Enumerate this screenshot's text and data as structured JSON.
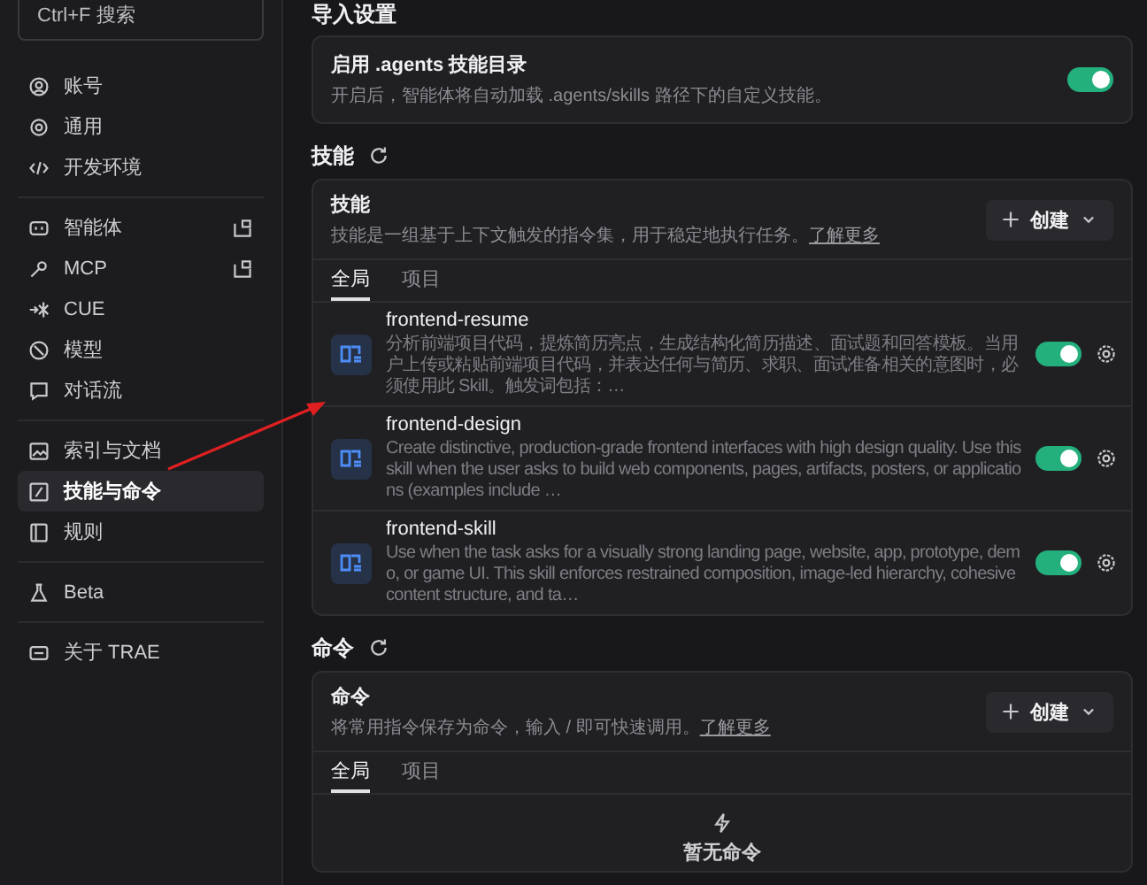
{
  "sidebar": {
    "search": {
      "placeholder": "Ctrl+F 搜索"
    },
    "groups": [
      {
        "items": [
          {
            "label": "账号",
            "selected": false,
            "external": false
          },
          {
            "label": "通用",
            "selected": false,
            "external": false
          },
          {
            "label": "开发环境",
            "selected": false,
            "external": false
          }
        ]
      },
      {
        "items": [
          {
            "label": "智能体",
            "selected": false,
            "external": true
          },
          {
            "label": "MCP",
            "selected": false,
            "external": true
          },
          {
            "label": "CUE",
            "selected": false,
            "external": false
          },
          {
            "label": "模型",
            "selected": false,
            "external": false
          },
          {
            "label": "对话流",
            "selected": false,
            "external": false
          }
        ]
      },
      {
        "items": [
          {
            "label": "索引与文档",
            "selected": false,
            "external": false
          },
          {
            "label": "技能与命令",
            "selected": true,
            "external": false
          },
          {
            "label": "规则",
            "selected": false,
            "external": false
          }
        ]
      },
      {
        "items": [
          {
            "label": "Beta",
            "selected": false,
            "external": false
          }
        ]
      },
      {
        "items": [
          {
            "label": "关于 TRAE",
            "selected": false,
            "external": false
          }
        ]
      }
    ]
  },
  "import_settings": {
    "heading": "导入设置",
    "title": "启用 .agents 技能目录",
    "description": "开启后，智能体将自动加载 .agents/skills 路径下的自定义技能。",
    "on": true
  },
  "skills": {
    "heading": "技能",
    "title": "技能",
    "description": "技能是一组基于上下文触发的指令集，用于稳定地执行任务。",
    "link": "了解更多",
    "create": "创建",
    "tabs": [
      {
        "label": "全局",
        "selected": true
      },
      {
        "label": "项目",
        "selected": false
      }
    ],
    "rows": [
      {
        "name": "frontend-resume",
        "description": "分析前端项目代码，提炼简历亮点，生成结构化简历描述、面试题和回答模板。当用户上传或粘贴前端项目代码，并表达任何与简历、求职、面试准备相关的意图时，必须使用此 Skill。触发词包括：…",
        "on": true
      },
      {
        "name": "frontend-design",
        "description": "Create distinctive, production-grade frontend interfaces with high design quality. Use this skill when the user asks to build web components, pages, artifacts, posters, or applications (examples include …",
        "on": true
      },
      {
        "name": "frontend-skill",
        "description": "Use when the task asks for a visually strong landing page, website, app, prototype, demo, or game UI. This skill enforces restrained composition, image-led hierarchy, cohesive content structure, and ta…",
        "on": true
      }
    ]
  },
  "commands": {
    "heading": "命令",
    "title": "命令",
    "description": "将常用指令保存为命令，输入 / 即可快速调用。",
    "link": "了解更多",
    "create": "创建",
    "tabs": [
      {
        "label": "全局",
        "selected": true
      },
      {
        "label": "项目",
        "selected": false
      }
    ],
    "empty_text": "暂无命令"
  }
}
